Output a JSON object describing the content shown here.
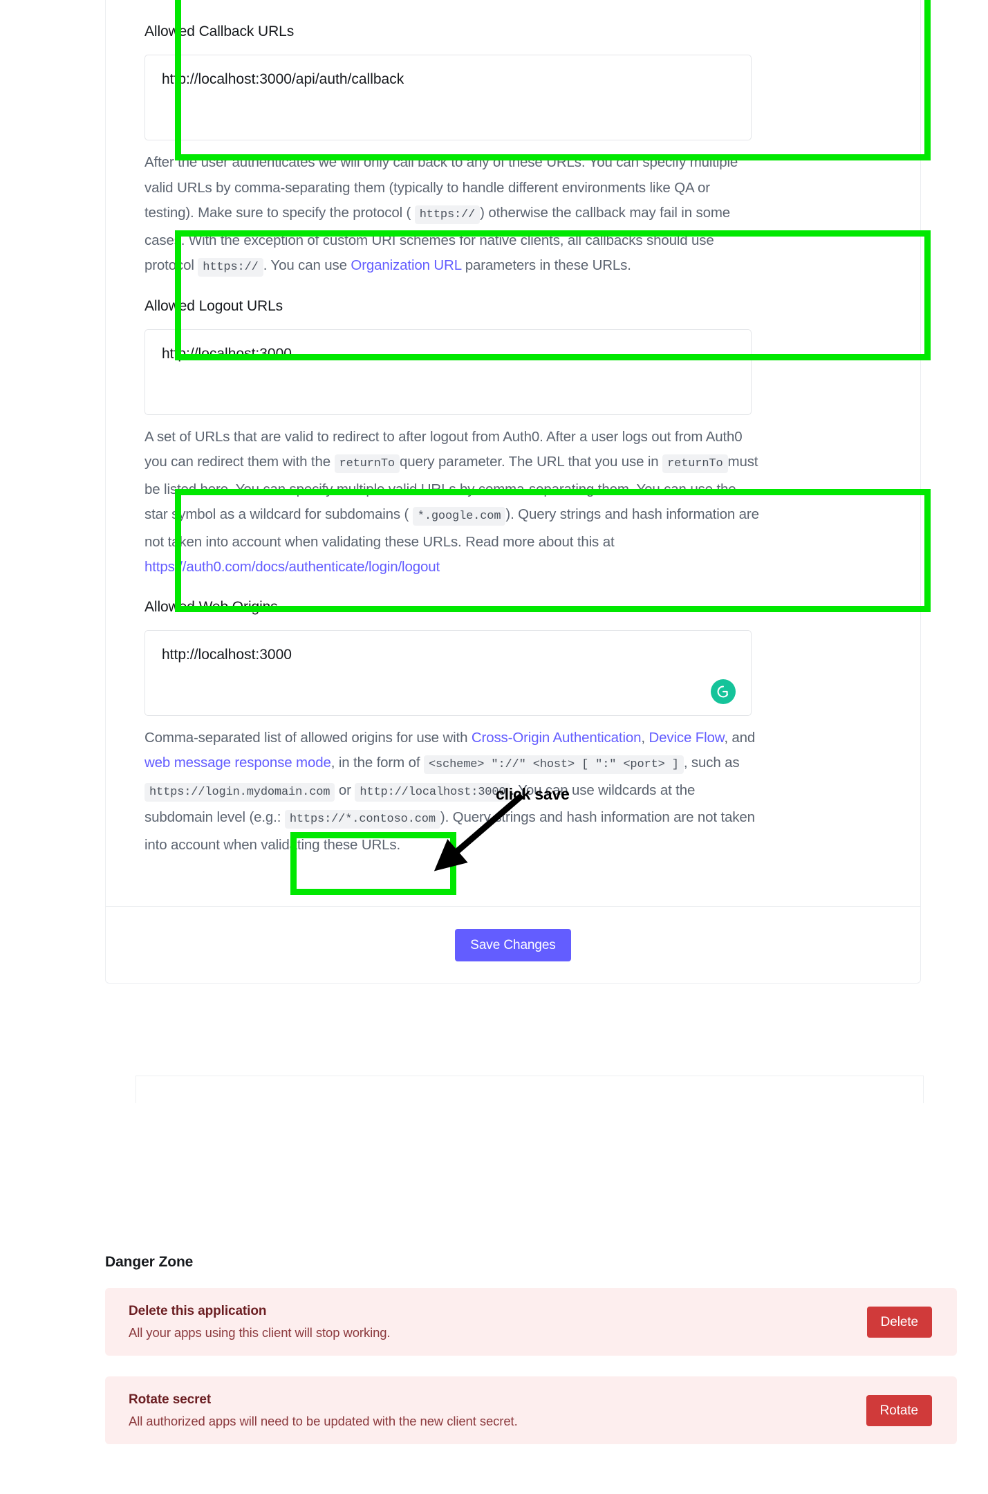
{
  "settings": {
    "fields": [
      {
        "id": "allowed-callback-urls",
        "label": "Allowed Callback URLs",
        "value": "http://localhost:3000/api/auth/callback",
        "has_grammarly": false
      },
      {
        "id": "allowed-logout-urls",
        "label": "Allowed Logout URLs",
        "value": "http://localhost:3000",
        "has_grammarly": false
      },
      {
        "id": "allowed-web-origins",
        "label": "Allowed Web Origins",
        "value": "http://localhost:3000",
        "has_grammarly": true,
        "grammarly_icon": "grammarly-icon"
      }
    ],
    "descriptions": {
      "callback": {
        "p1": "After the user authenticates we will only call back to any of these URLs. You can specify multiple valid URLs by comma-separating them (typically to handle different environments like QA or testing). Make sure to specify the protocol (",
        "code1": "https://",
        "p2": ") otherwise the callback may fail in some cases. With the exception of custom URI schemes for native clients, all callbacks should use protocol",
        "code2": "https://",
        "p3": ". You can use",
        "link1": "Organization URL",
        "p4": "parameters in these URLs."
      },
      "logout": {
        "p1": "A set of URLs that are valid to redirect to after logout from Auth0. After a user logs out from Auth0 you can redirect them with the",
        "code1": "returnTo",
        "p2": "query parameter. The URL that you use in",
        "code2": "returnTo",
        "p3": "must be listed here. You can specify multiple valid URLs by comma-separating them. You can use the star symbol as a wildcard for subdomains (",
        "code3": "*.google.com",
        "p4": "). Query strings and hash information are not taken into account when validating these URLs. Read more about this at",
        "link1": "https://auth0.com/docs/authenticate/login/logout"
      },
      "origins": {
        "p1": "Comma-separated list of allowed origins for use with",
        "link1": "Cross-Origin Authentication",
        "sep1": ",",
        "link2": "Device Flow",
        "sep2": ", and",
        "link3": "web message response mode",
        "p2": ", in the form of",
        "code1": "<scheme> \"://\" <host> [ \":\" <port> ]",
        "p3": ", such as",
        "code2": "https://login.mydomain.com",
        "p4": "or",
        "code3": "http://localhost:3000",
        "p5": ". You can use wildcards at the subdomain level (e.g.:",
        "code4": "https://*.contoso.com",
        "p6": "). Query strings and hash information are not taken into account when validating these URLs."
      }
    },
    "save_button_label": "Save Changes"
  },
  "annotation": {
    "click_save_text": "click save",
    "highlight_color": "#00e800",
    "arrow_color": "#000000"
  },
  "danger_zone": {
    "title": "Danger Zone",
    "items": [
      {
        "title": "Delete this application",
        "subtitle": "All your apps using this client will stop working.",
        "button_label": "Delete"
      },
      {
        "title": "Rotate secret",
        "subtitle": "All authorized apps will need to be updated with the new client secret.",
        "button_label": "Rotate"
      }
    ],
    "button_color": "#d03a3a",
    "panel_color": "#fdeeee"
  },
  "theme": {
    "accent": "#635dff",
    "grammarly_green": "#15c39a"
  }
}
